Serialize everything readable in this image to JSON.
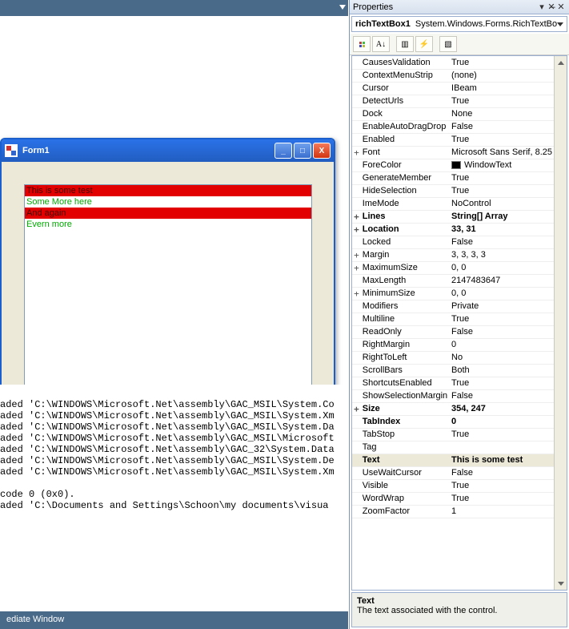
{
  "topbar": {
    "immediate_window_label": "ediate Window"
  },
  "form1": {
    "title": "Form1",
    "lines": {
      "l0": "This is some test",
      "l1": "Some More here",
      "l2": "And again",
      "l3": "Evern more"
    }
  },
  "debug": {
    "l0": "aded 'C:\\WINDOWS\\Microsoft.Net\\assembly\\GAC_MSIL\\System.Co",
    "l1": "aded 'C:\\WINDOWS\\Microsoft.Net\\assembly\\GAC_MSIL\\System.Xm",
    "l2": "aded 'C:\\WINDOWS\\Microsoft.Net\\assembly\\GAC_MSIL\\System.Da",
    "l3": "aded 'C:\\WINDOWS\\Microsoft.Net\\assembly\\GAC_MSIL\\Microsoft",
    "l4": "aded 'C:\\WINDOWS\\Microsoft.Net\\assembly\\GAC_32\\System.Data",
    "l5": "aded 'C:\\WINDOWS\\Microsoft.Net\\assembly\\GAC_MSIL\\System.De",
    "l6": "aded 'C:\\WINDOWS\\Microsoft.Net\\assembly\\GAC_MSIL\\System.Xm",
    "l7": "",
    "l8": "code 0 (0x0).",
    "l9": "aded 'C:\\Documents and Settings\\Schoon\\my documents\\visua"
  },
  "props": {
    "panel_title": "Properties",
    "object_name": "richTextBox1",
    "object_type": "System.Windows.Forms.RichTextBo",
    "toolbar": {
      "cat": "▭",
      "sort": "A↓",
      "page": "▭",
      "bolt": "⚡",
      "page2": "▭"
    },
    "rows": [
      {
        "plus": "",
        "name": "CausesValidation",
        "val": "True"
      },
      {
        "plus": "",
        "name": "ContextMenuStrip",
        "val": "(none)"
      },
      {
        "plus": "",
        "name": "Cursor",
        "val": "IBeam"
      },
      {
        "plus": "",
        "name": "DetectUrls",
        "val": "True"
      },
      {
        "plus": "",
        "name": "Dock",
        "val": "None"
      },
      {
        "plus": "",
        "name": "EnableAutoDragDrop",
        "val": "False"
      },
      {
        "plus": "",
        "name": "Enabled",
        "val": "True"
      },
      {
        "plus": "+",
        "name": "Font",
        "val": "Microsoft Sans Serif, 8.25"
      },
      {
        "plus": "",
        "name": "ForeColor",
        "val": "WindowText",
        "color": true
      },
      {
        "plus": "",
        "name": "GenerateMember",
        "val": "True"
      },
      {
        "plus": "",
        "name": "HideSelection",
        "val": "True"
      },
      {
        "plus": "",
        "name": "ImeMode",
        "val": "NoControl"
      },
      {
        "plus": "+",
        "name": "Lines",
        "val": "String[] Array",
        "bold": true
      },
      {
        "plus": "+",
        "name": "Location",
        "val": "33, 31",
        "bold": true
      },
      {
        "plus": "",
        "name": "Locked",
        "val": "False"
      },
      {
        "plus": "+",
        "name": "Margin",
        "val": "3, 3, 3, 3"
      },
      {
        "plus": "+",
        "name": "MaximumSize",
        "val": "0, 0"
      },
      {
        "plus": "",
        "name": "MaxLength",
        "val": "2147483647"
      },
      {
        "plus": "+",
        "name": "MinimumSize",
        "val": "0, 0"
      },
      {
        "plus": "",
        "name": "Modifiers",
        "val": "Private"
      },
      {
        "plus": "",
        "name": "Multiline",
        "val": "True"
      },
      {
        "plus": "",
        "name": "ReadOnly",
        "val": "False"
      },
      {
        "plus": "",
        "name": "RightMargin",
        "val": "0"
      },
      {
        "plus": "",
        "name": "RightToLeft",
        "val": "No"
      },
      {
        "plus": "",
        "name": "ScrollBars",
        "val": "Both"
      },
      {
        "plus": "",
        "name": "ShortcutsEnabled",
        "val": "True"
      },
      {
        "plus": "",
        "name": "ShowSelectionMargin",
        "val": "False"
      },
      {
        "plus": "+",
        "name": "Size",
        "val": "354, 247",
        "bold": true
      },
      {
        "plus": "",
        "name": "TabIndex",
        "val": "0",
        "bold": true
      },
      {
        "plus": "",
        "name": "TabStop",
        "val": "True"
      },
      {
        "plus": "",
        "name": "Tag",
        "val": ""
      },
      {
        "plus": "",
        "name": "Text",
        "val": "This is some test",
        "bold": true,
        "sel": true
      },
      {
        "plus": "",
        "name": "UseWaitCursor",
        "val": "False"
      },
      {
        "plus": "",
        "name": "Visible",
        "val": "True"
      },
      {
        "plus": "",
        "name": "WordWrap",
        "val": "True"
      },
      {
        "plus": "",
        "name": "ZoomFactor",
        "val": "1"
      }
    ],
    "desc": {
      "title": "Text",
      "body": "The text associated with the control."
    }
  }
}
